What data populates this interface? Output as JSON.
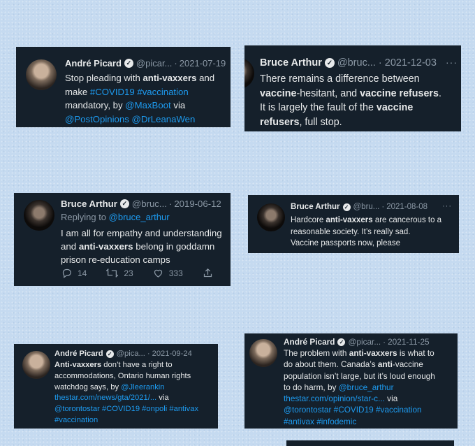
{
  "tweets": {
    "t1": {
      "name": "André Picard",
      "handle": "@picar...",
      "sep": "·",
      "date": "2021-07-19",
      "lines": [
        [
          {
            "t": "Stop pleading with "
          },
          {
            "t": "anti-vaxxers",
            "s": "b"
          },
          {
            "t": " and"
          }
        ],
        [
          {
            "t": "make "
          },
          {
            "t": "#COVID19",
            "s": "link"
          },
          {
            "t": " "
          },
          {
            "t": "#vaccination",
            "s": "link"
          }
        ],
        [
          {
            "t": "mandatory, by "
          },
          {
            "t": "@MaxBoot",
            "s": "link"
          },
          {
            "t": " via"
          }
        ],
        [
          {
            "t": "@PostOpinions",
            "s": "link"
          },
          {
            "t": " "
          },
          {
            "t": "@DrLeanaWen",
            "s": "link"
          }
        ]
      ]
    },
    "t2": {
      "name": "Bruce Arthur",
      "handle": "@bruc...",
      "sep": "·",
      "date": "2021-12-03",
      "more": "···",
      "lines": [
        [
          {
            "t": "There remains a difference between"
          }
        ],
        [
          {
            "t": "vaccine",
            "s": "b"
          },
          {
            "t": "-hesitant, and "
          },
          {
            "t": "vaccine refusers",
            "s": "b"
          },
          {
            "t": "."
          }
        ],
        [
          {
            "t": "It is largely the fault of the "
          },
          {
            "t": "vaccine",
            "s": "b"
          }
        ],
        [
          {
            "t": "refusers",
            "s": "b"
          },
          {
            "t": ", full stop."
          }
        ]
      ]
    },
    "t3": {
      "name": "Bruce Arthur",
      "handle": "@bruc...",
      "sep": "·",
      "date": "2019-06-12",
      "replying_prefix": "Replying to ",
      "replying_handle": "@bruce_arthur",
      "lines": [
        [
          {
            "t": "I am all for empathy and understanding"
          }
        ],
        [
          {
            "t": "and "
          },
          {
            "t": "anti-vaxxers",
            "s": "b"
          },
          {
            "t": " belong in goddamn"
          }
        ],
        [
          {
            "t": "prison re-education camps"
          }
        ]
      ],
      "replies": "14",
      "retweets": "23",
      "likes": "333"
    },
    "t4": {
      "name": "Bruce Arthur",
      "handle": "@bru...",
      "sep": "·",
      "date": "2021-08-08",
      "more": "···",
      "lines": [
        [
          {
            "t": "Hardcore "
          },
          {
            "t": "anti-vaxxers",
            "s": "b"
          },
          {
            "t": " are cancerous to a"
          }
        ],
        [
          {
            "t": "reasonable society. It’s really sad."
          }
        ],
        [
          {
            "t": "Vaccine passports now, please"
          }
        ]
      ]
    },
    "t5": {
      "name": "André Picard",
      "handle": "@pica...",
      "sep": "·",
      "date": "2021-09-24",
      "lines": [
        [
          {
            "t": "Anti-vaxxers",
            "s": "b"
          },
          {
            "t": " don’t have a right to"
          }
        ],
        [
          {
            "t": "accommodations, Ontario human rights"
          }
        ],
        [
          {
            "t": "watchdog says, by "
          },
          {
            "t": "@Jleerankin",
            "s": "link"
          }
        ],
        [
          {
            "t": "thestar.com/news/gta/2021/...",
            "s": "link"
          },
          {
            "t": " via"
          }
        ],
        [
          {
            "t": "@torontostar",
            "s": "link"
          },
          {
            "t": " "
          },
          {
            "t": "#COVID19",
            "s": "link"
          },
          {
            "t": " "
          },
          {
            "t": "#onpoli",
            "s": "link"
          },
          {
            "t": " "
          },
          {
            "t": "#antivax",
            "s": "link"
          }
        ],
        [
          {
            "t": "#vaccination",
            "s": "link"
          }
        ]
      ]
    },
    "t6": {
      "name": "André Picard",
      "handle": "@picar...",
      "sep": "·",
      "date": "2021-11-25",
      "lines": [
        [
          {
            "t": "The problem with "
          },
          {
            "t": "anti-vaxxers",
            "s": "b"
          },
          {
            "t": " is what to"
          }
        ],
        [
          {
            "t": "do about them. Canada’s "
          },
          {
            "t": "anti",
            "s": "b"
          },
          {
            "t": "-vaccine"
          }
        ],
        [
          {
            "t": "population isn’t large, but it’s loud enough"
          }
        ],
        [
          {
            "t": "to do harm, by "
          },
          {
            "t": "@bruce_arthur",
            "s": "link"
          }
        ],
        [
          {
            "t": "thestar.com/opinion/star-c...",
            "s": "link"
          },
          {
            "t": " via"
          }
        ],
        [
          {
            "t": "@torontostar",
            "s": "link"
          },
          {
            "t": " "
          },
          {
            "t": "#COVID19",
            "s": "link"
          },
          {
            "t": " "
          },
          {
            "t": "#vaccination",
            "s": "link"
          }
        ],
        [
          {
            "t": "#antivax",
            "s": "link"
          },
          {
            "t": " "
          },
          {
            "t": "#infodemic",
            "s": "link"
          }
        ]
      ]
    }
  },
  "icons": {
    "verified": "verified-badge-icon",
    "reply": "reply-icon",
    "retweet": "retweet-icon",
    "like": "heart-icon",
    "share": "share-icon",
    "more": "more-dots-icon"
  },
  "colors": {
    "card_bg": "#15202b",
    "link": "#1d9bf0",
    "text": "#e7e9ea",
    "muted": "#8b98a5",
    "page_bg": "#c5daf0"
  }
}
